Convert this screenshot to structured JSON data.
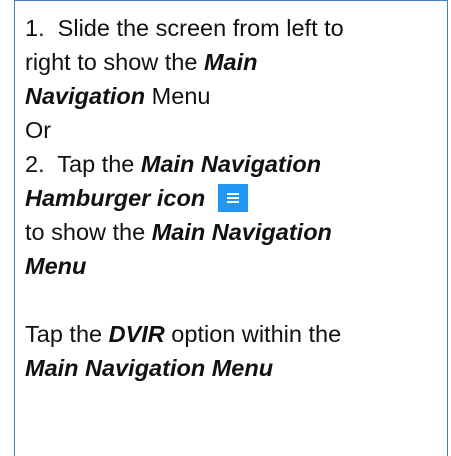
{
  "instructions": {
    "step1_number": "1.",
    "step1_a": "Slide the screen from left to",
    "step1_b": "right to show the",
    "step1_c_emph": "Main",
    "step1_d_emph": "Navigation",
    "step1_d_rest": " Menu",
    "or_text": "Or",
    "step2_number": "2.",
    "step2_a": "Tap the ",
    "step2_a_emph": "Main Navigation",
    "step2_b_emph": "Hamburger icon",
    "step2_c": "to show the ",
    "step2_c_emph": "Main Navigation",
    "step2_d_emph": "Menu",
    "step3_a": "Tap the ",
    "step3_a_emph": "DVIR",
    "step3_a_rest": " option within the",
    "step3_b_emph": "Main Navigation Menu"
  },
  "colors": {
    "border": "#4f7bbd",
    "icon_background": "#2196f3"
  },
  "icons": {
    "inline_icon": "hamburger-menu-icon"
  }
}
